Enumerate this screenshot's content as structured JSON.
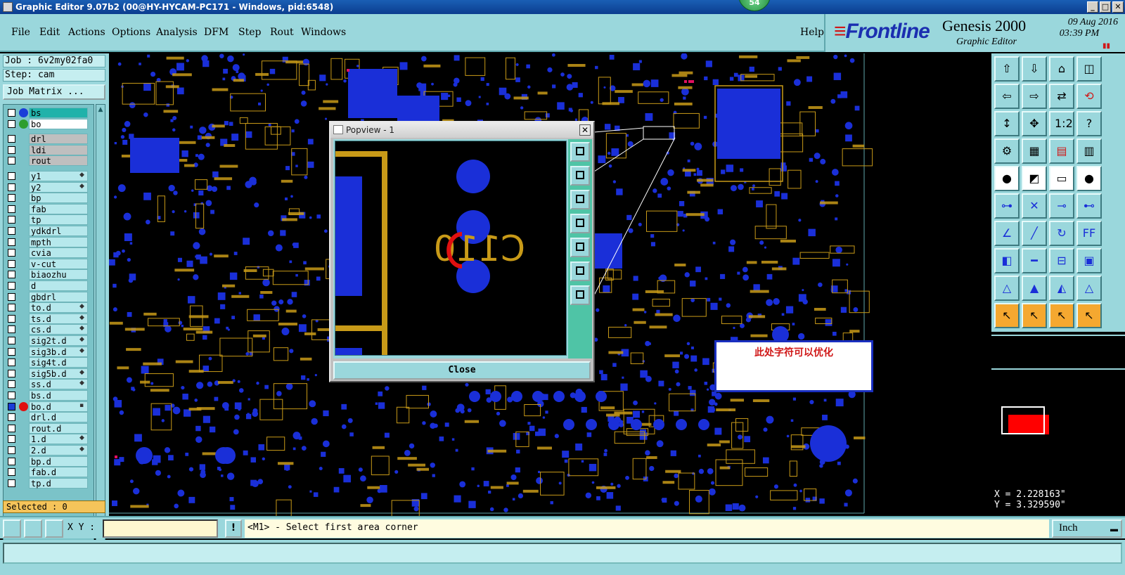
{
  "window": {
    "title": "Graphic Editor 9.07b2 (00@HY-HYCAM-PC171 - Windows, pid:6548)",
    "badge": "54",
    "controls": [
      "_",
      "□",
      "✕"
    ]
  },
  "menu": {
    "items": [
      {
        "label": "File"
      },
      {
        "label": "Edit"
      },
      {
        "label": "Actions"
      },
      {
        "label": "Options"
      },
      {
        "label": "Analysis"
      },
      {
        "label": "DFM"
      },
      {
        "label": "Step"
      },
      {
        "label": "Rout"
      },
      {
        "label": "Windows"
      }
    ],
    "help": "Help"
  },
  "brand": {
    "logo": "Frontline",
    "product": "Genesis 2000",
    "subtitle": "Graphic Editor",
    "date": "09 Aug 2016",
    "time": "03:39 PM",
    "pause_icon": "pause-icon"
  },
  "left": {
    "job": "Job : 6v2my02fa0",
    "step": "Step: cam",
    "job_matrix": "Job Matrix ...",
    "selected": "Selected : 0",
    "layers": [
      {
        "name": "bs",
        "dot": "#1a3dd8",
        "style": "sel"
      },
      {
        "name": "bo",
        "dot": "#2e9e2e",
        "style": "white"
      },
      {
        "name": "drl",
        "style": "gray"
      },
      {
        "name": "ldi",
        "style": "gray"
      },
      {
        "name": "rout",
        "style": "gray"
      },
      {
        "name": "y1",
        "mark": "◆"
      },
      {
        "name": "y2",
        "mark": "◆"
      },
      {
        "name": "bp"
      },
      {
        "name": "fab"
      },
      {
        "name": "tp"
      },
      {
        "name": "ydkdrl"
      },
      {
        "name": "mpth"
      },
      {
        "name": "cvia"
      },
      {
        "name": "v-cut"
      },
      {
        "name": "biaozhu"
      },
      {
        "name": "d"
      },
      {
        "name": "gbdrl"
      },
      {
        "name": "to.d",
        "mark": "◆"
      },
      {
        "name": "ts.d",
        "mark": "◆"
      },
      {
        "name": "cs.d",
        "mark": "◆"
      },
      {
        "name": "sig2t.d",
        "mark": "◆"
      },
      {
        "name": "sig3b.d",
        "mark": "◆"
      },
      {
        "name": "sig4t.d"
      },
      {
        "name": "sig5b.d",
        "mark": "◆"
      },
      {
        "name": "ss.d",
        "mark": "◆"
      },
      {
        "name": "bs.d"
      },
      {
        "name": "bo.d",
        "dot": "#e01010",
        "active": true,
        "mark": "▪"
      },
      {
        "name": "drl.d"
      },
      {
        "name": "rout.d"
      },
      {
        "name": "1.d",
        "mark": "◆"
      },
      {
        "name": "2.d",
        "mark": "◆"
      },
      {
        "name": "bp.d"
      },
      {
        "name": "fab.d"
      },
      {
        "name": "tp.d"
      }
    ]
  },
  "popview": {
    "title": "Popview - 1",
    "close_label": "Close",
    "component_label": "C110"
  },
  "note": {
    "text": "此处字符可以优化"
  },
  "coords": {
    "x": "X = 2.228163\"",
    "y": "Y = 3.329590\""
  },
  "bottom": {
    "xy_label": "X Y :",
    "xy_value": "",
    "bang": "!",
    "prompt": "<M1> - Select first area corner",
    "units": "Inch"
  },
  "colors": {
    "panel": "#9ad7dc",
    "pad": "#1a2fd8",
    "silk": "#c89a18",
    "highlight": "#e01010"
  }
}
